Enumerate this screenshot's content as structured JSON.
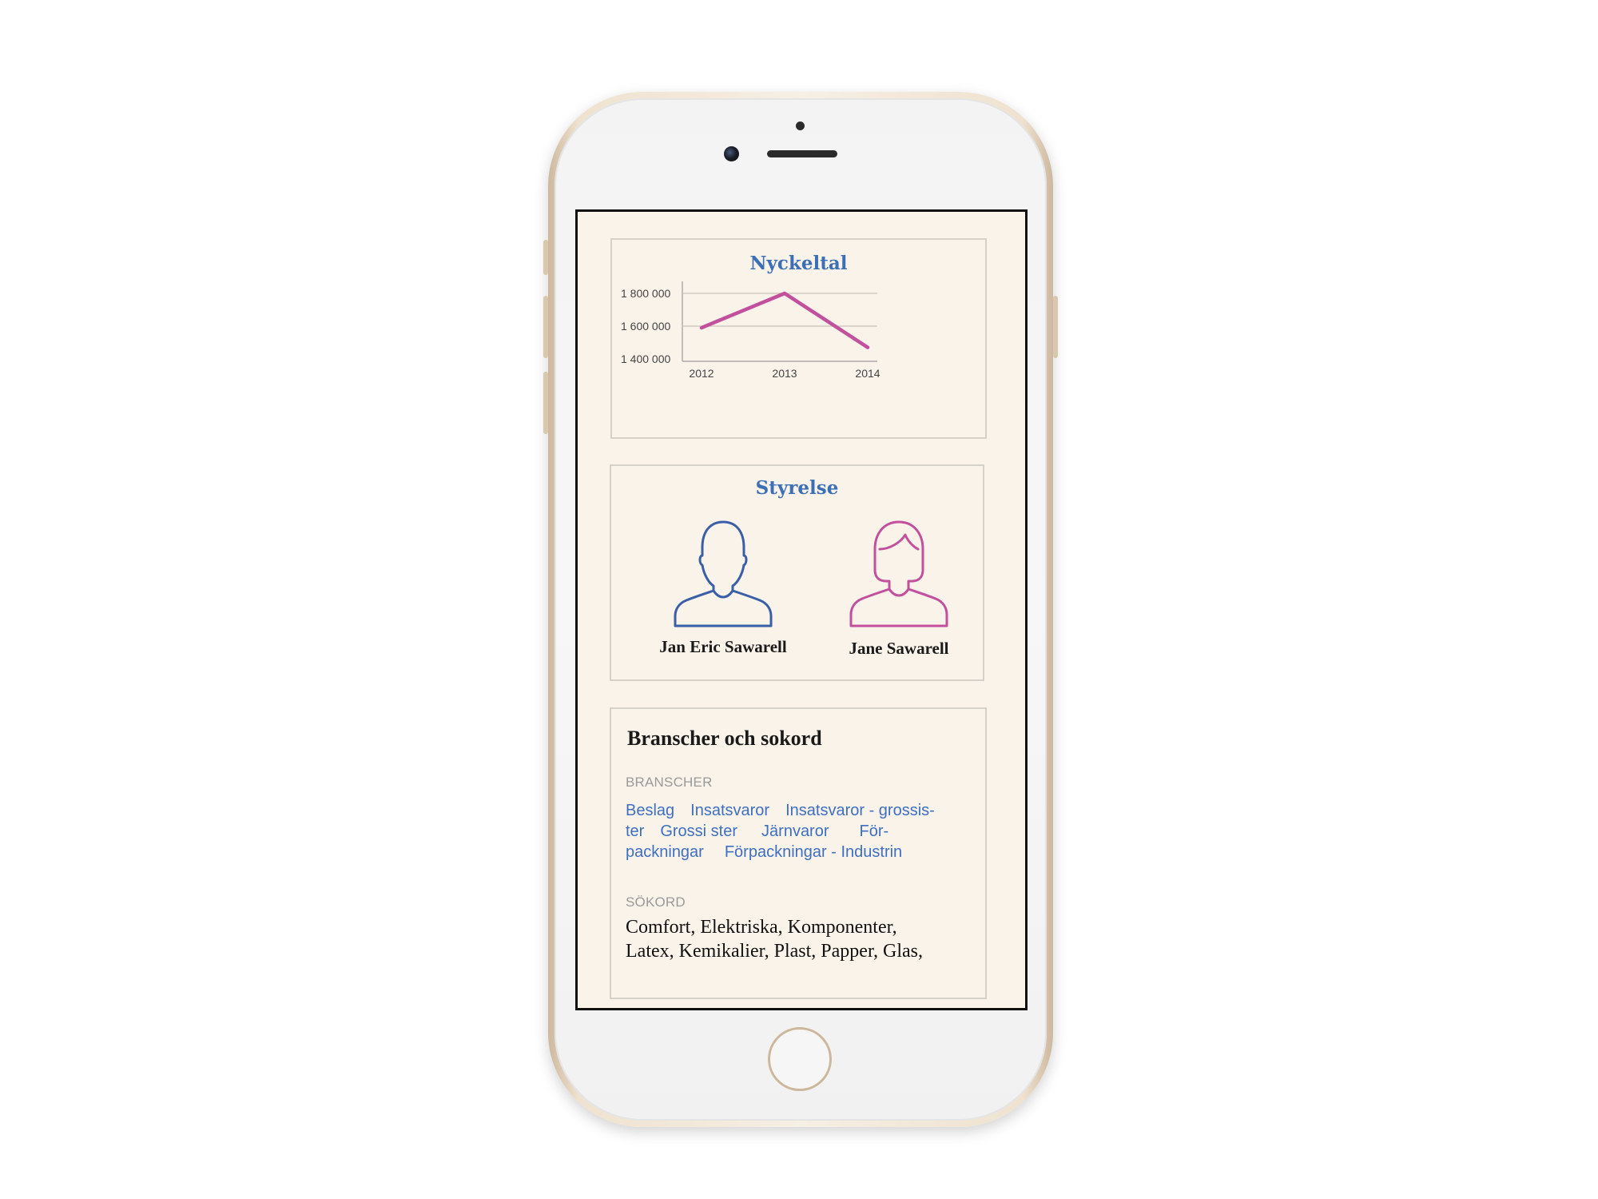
{
  "nyckeltal": {
    "title": "Nyckeltal"
  },
  "chart_data": {
    "type": "line",
    "title": "Nyckeltal",
    "x": [
      "2012",
      "2013",
      "2014"
    ],
    "series": [
      {
        "values": [
          1590000,
          1800000,
          1470000
        ]
      }
    ],
    "ylim": [
      1400000,
      1800000
    ],
    "yticks": [
      1400000,
      1600000,
      1800000
    ],
    "ytick_labels": [
      "1 400 000",
      "1 600 000",
      "1 800 000"
    ],
    "grid": true,
    "line_color": "#c2509c"
  },
  "styrelse": {
    "title": "Styrelse",
    "members": [
      {
        "name": "Jan Eric Sawarell",
        "icon": "male-person-icon",
        "color": "#3a5fa7"
      },
      {
        "name": "Jane Sawarell",
        "icon": "female-person-icon",
        "color": "#c2509c"
      }
    ]
  },
  "branscher": {
    "heading": "Branscher och sokord",
    "branscher_label": "BRANSCHER",
    "tags": [
      "Beslag",
      "Insatsvaror",
      "Insatsvaror - grossis-",
      "ter",
      "Grossi ster",
      "Järnvaror",
      "För-",
      "packningar",
      "Förpackningar - Industrin"
    ],
    "sokord_label": "SÖKORD",
    "sokord_lines": [
      "Comfort, Elektriska, Komponenter,",
      "Latex, Kemikalier, Plast, Papper, Glas,"
    ]
  },
  "colors": {
    "accent_blue": "#3c6fb6",
    "accent_pink": "#c2509c",
    "screen_bg": "#f9f3ea"
  }
}
